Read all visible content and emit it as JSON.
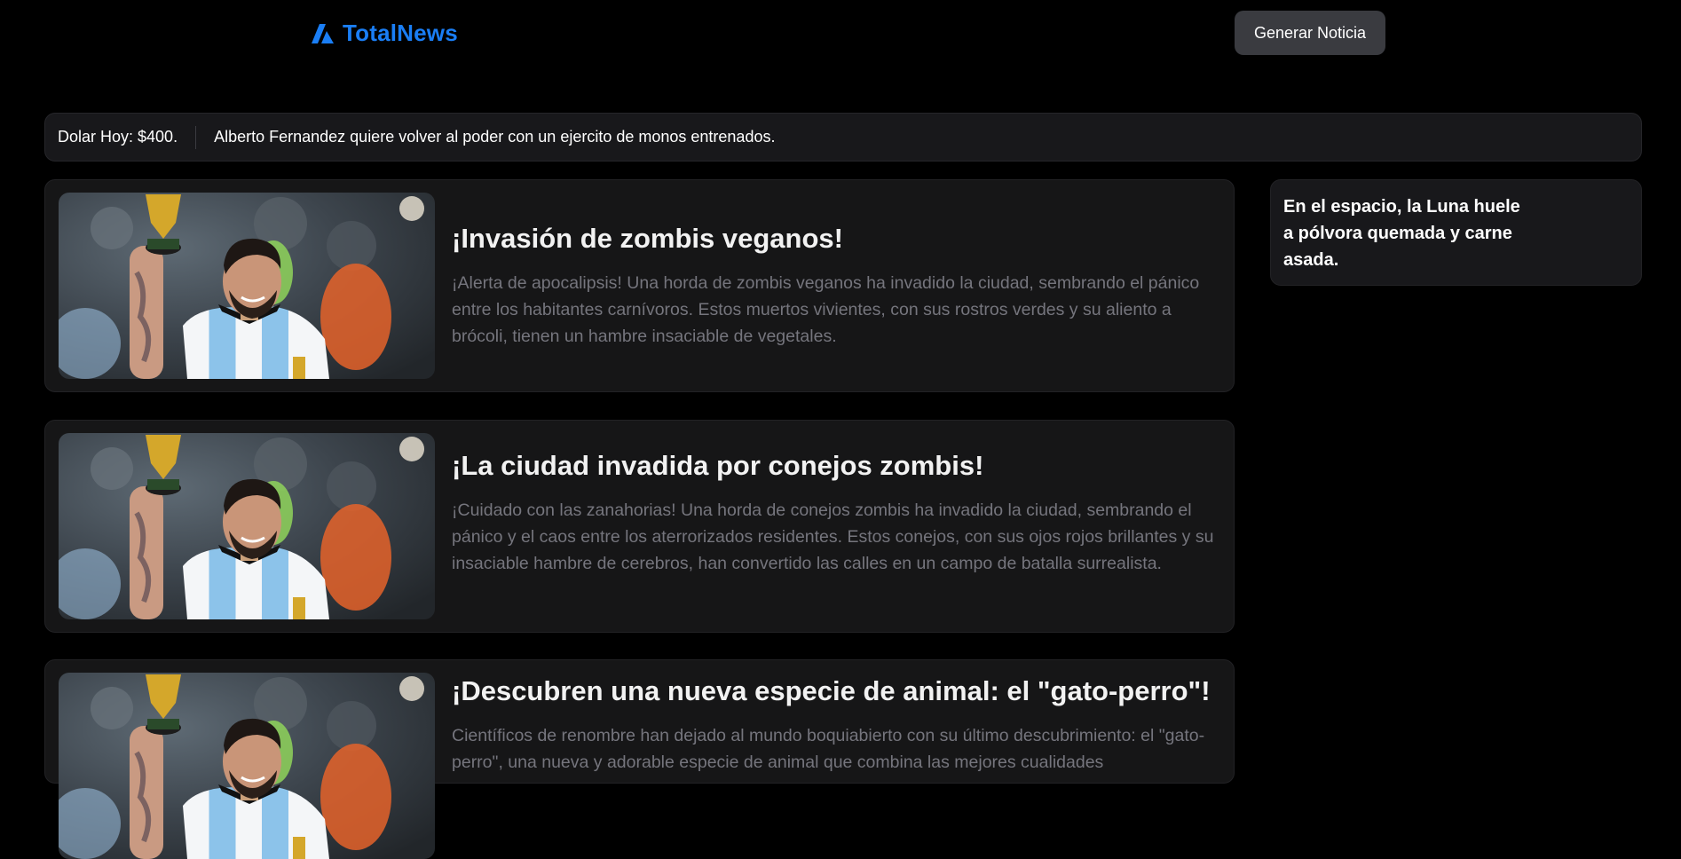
{
  "header": {
    "logo_text": "TotalNews",
    "generate_button": "Generar Noticia"
  },
  "ticker": {
    "dollar": "Dolar Hoy: $400.",
    "headline": "Alberto Fernandez quiere volver al poder con un ejercito de monos entrenados."
  },
  "articles": [
    {
      "title": "¡Invasión de zombis veganos!",
      "text": "¡Alerta de apocalipsis! Una horda de zombis veganos ha invadido la ciudad, sembrando el pánico entre los habitantes carnívoros. Estos muertos vivientes, con sus rostros verdes y su aliento a brócoli, tienen un hambre insaciable de vegetales."
    },
    {
      "title": "¡La ciudad invadida por conejos zombis!",
      "text": "¡Cuidado con las zanahorias! Una horda de conejos zombis ha invadido la ciudad, sembrando el pánico y el caos entre los aterrorizados residentes. Estos conejos, con sus ojos rojos brillantes y su insaciable hambre de cerebros, han convertido las calles en un campo de batalla surrealista."
    },
    {
      "title": "¡Descubren una nueva especie de animal: el \"gato-perro\"!",
      "text": "Científicos de renombre han dejado al mundo boquiabierto con su último descubrimiento: el \"gato-perro\", una nueva y adorable especie de animal que combina las mejores cualidades"
    }
  ],
  "sidebar": {
    "story": "En el espacio, la Luna huele a pólvora quemada y carne asada."
  },
  "colors": {
    "background": "#000000",
    "brand": "#1a7ef5",
    "card": "#161617",
    "button": "#3a3b40",
    "muted_text": "#75757d"
  }
}
